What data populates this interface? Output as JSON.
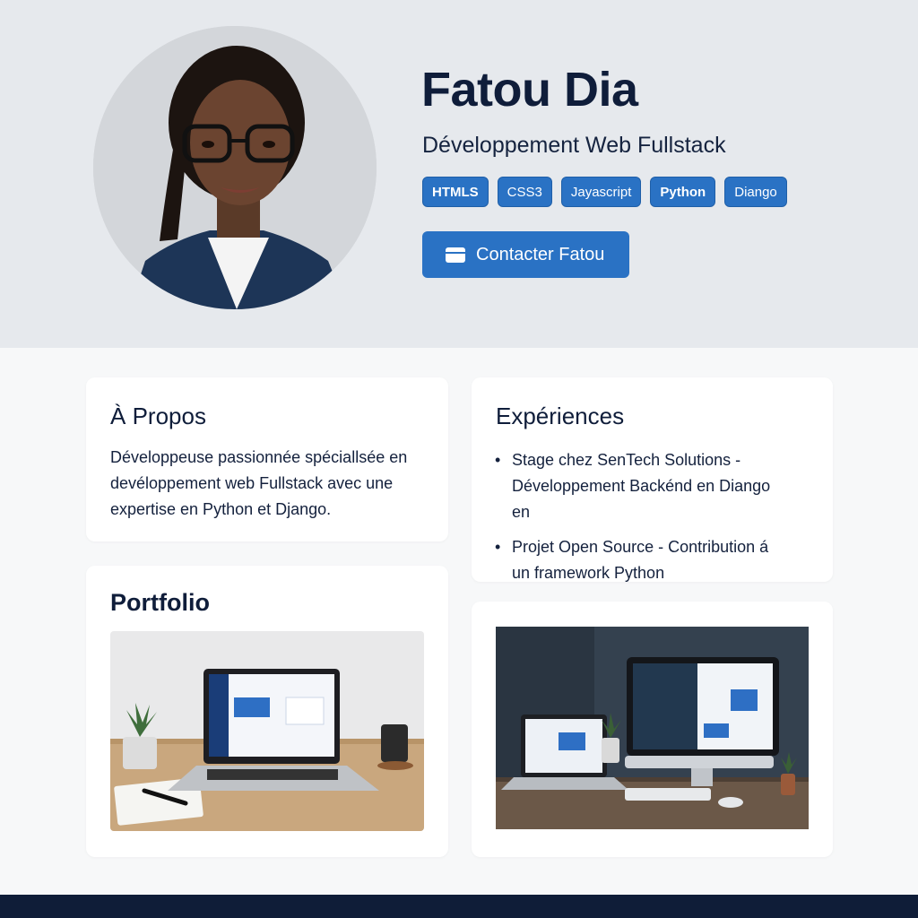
{
  "profile": {
    "name": "Fatou Dia",
    "role": "Développement Web Fullstack",
    "avatar_icon": "profile-photo"
  },
  "skills": [
    {
      "label": "HTMLS",
      "bold": true
    },
    {
      "label": "CSS3",
      "bold": false
    },
    {
      "label": "Jayascript",
      "bold": false
    },
    {
      "label": "Python",
      "bold": true
    },
    {
      "label": "Diango",
      "bold": false
    }
  ],
  "contact": {
    "label": "Contacter Fatou",
    "icon": "card-icon"
  },
  "about": {
    "title": "À Propos",
    "text": "Développeuse passionnée spéciallsée en devéloppement web Fullstack avec une expertise en Python et Django."
  },
  "experiences": {
    "title": "Expériences",
    "items": [
      "Stage chez SenTech Solutions - Développement Backénd en Diango en",
      "Projet Open Source - Contribution á un framework Python"
    ]
  },
  "portfolio": {
    "title": "Portfolio"
  },
  "colors": {
    "accent": "#2a72c4",
    "hero_bg": "#e6e9ed",
    "heading": "#0f1d3a",
    "footer": "#0f1d38"
  }
}
